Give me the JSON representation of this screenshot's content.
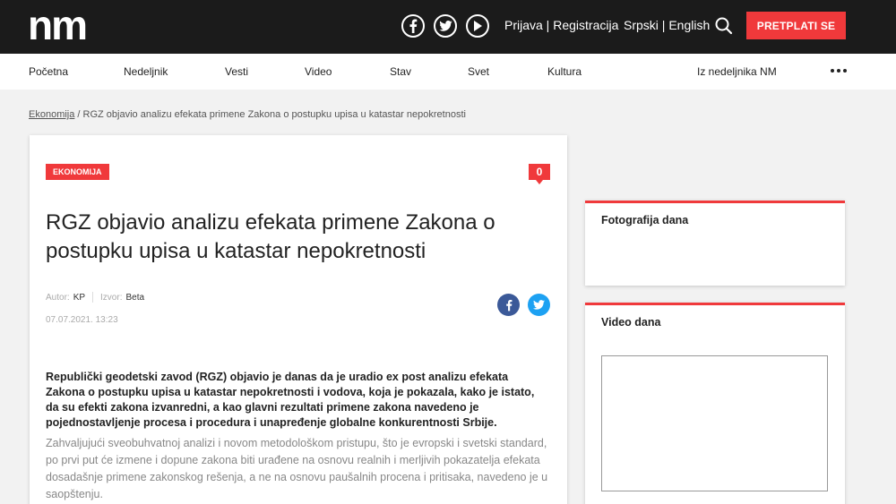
{
  "header": {
    "logo_text": "nm",
    "social": [
      "facebook-icon",
      "twitter-icon",
      "youtube-play-icon"
    ],
    "login": "Prijava",
    "register": "Registracija",
    "auth_sep": " | ",
    "lang_sr": "Srpski",
    "lang_sep": " | ",
    "lang_en": "English",
    "subscribe_label": "PRETPLATI SE",
    "accent_color": "#f0393b"
  },
  "nav": {
    "items": [
      "Početna",
      "Nedeljnik",
      "Vesti",
      "Video",
      "Stav",
      "Svet",
      "Kultura",
      "Iz nedeljnika NM"
    ],
    "more_icon": "more-dots-icon"
  },
  "breadcrumb": {
    "category": "Ekonomija",
    "separator": " / ",
    "current": "RGZ objavio analizu efekata primene Zakona o postupku upisa u katastar nepokretnosti"
  },
  "article": {
    "category": "EKONOMIJA",
    "comment_count": "0",
    "title": "RGZ objavio analizu efekata primene Zakona o postupku upisa u katastar nepokretnosti",
    "author_label": "Autor:",
    "author": "KP",
    "source_label": "Izvor:",
    "source": "Beta",
    "date": "07.07.2021. 13:23",
    "lead": "Republički geodetski zavod (RGZ) objavio je danas da je uradio ex post analizu efekata Zakona o postupku upisa u katastar nepokretnosti i vodova, koja je pokazala, kako je istato, da su efekti zakona izvanredni, a kao glavni rezultati primene zakona navedeno je pojednostavljenje procesa i procedura i unapređenje globalne konkurentnosti Srbije.",
    "body": "Zahvaljujući sveobuhvatnoj analizi i novom metodološkom pristupu, što je evropski i svetski standard, po prvi put će izmene i dopune zakona biti urađene na osnovu realnih i merljivih pokazatelja efekata dosadašnje primene zakonskog rešenja, a ne na osnovu paušalnih procena i pritisaka, navedeno je u saopštenju."
  },
  "sidebar": {
    "photo_title": "Fotografija dana",
    "video_title": "Video dana"
  }
}
